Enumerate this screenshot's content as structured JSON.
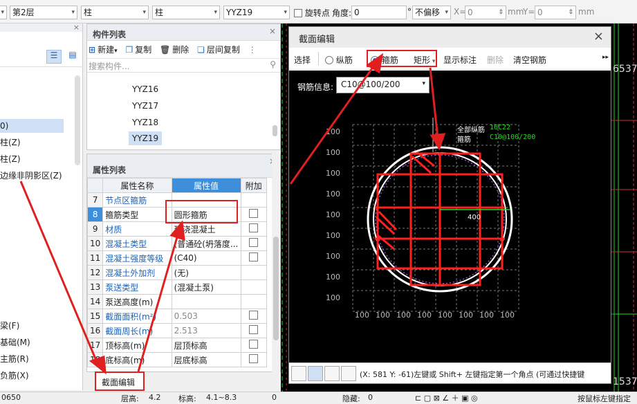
{
  "toolbar": {
    "floor": "第2层",
    "category": "柱",
    "subcategory": "柱",
    "component": "YYZ19",
    "rotate_point_label": "旋转点",
    "angle_label": "角度:",
    "angle_value": "0",
    "angle_unit": "°",
    "offset_mode": "不偏移",
    "x_label": "X=",
    "x_value": "0",
    "x_unit": "mm",
    "y_label": "Y=",
    "y_value": "0",
    "y_unit": "mm"
  },
  "tree": {
    "items": [
      "0)",
      "柱(Z)",
      "柱(Z)",
      "边缘非阴影区(Z)",
      "梁(F)",
      "基础(M)",
      "主筋(R)",
      "负筋(X)"
    ]
  },
  "component_list": {
    "title": "构件列表",
    "buttons": {
      "new": "新建",
      "copy": "复制",
      "delete": "删除",
      "floor_copy": "层间复制"
    },
    "search_placeholder": "搜索构件...",
    "items": [
      "YYZ16",
      "YYZ17",
      "YYZ18",
      "YYZ19"
    ],
    "selected": "YYZ19"
  },
  "property_list": {
    "title": "属性列表",
    "headers": {
      "name": "属性名称",
      "value": "属性值",
      "extra": "附加"
    },
    "rows": [
      {
        "no": "7",
        "name": "节点区箍筋",
        "value": ""
      },
      {
        "no": "8",
        "name": "箍筋类型",
        "value": "圆形箍筋"
      },
      {
        "no": "9",
        "name": "材质",
        "value": "现浇混凝土"
      },
      {
        "no": "10",
        "name": "混凝土类型",
        "value": "(普通砼(坍落度..."
      },
      {
        "no": "11",
        "name": "混凝土强度等级",
        "value": "(C40)"
      },
      {
        "no": "12",
        "name": "混凝土外加剂",
        "value": "(无)"
      },
      {
        "no": "13",
        "name": "泵送类型",
        "value": "(混凝土泵)"
      },
      {
        "no": "14",
        "name": "泵送高度(m)",
        "value": ""
      },
      {
        "no": "15",
        "name": "截面面积(m²)",
        "value": "0.503"
      },
      {
        "no": "16",
        "name": "截面周长(m)",
        "value": "2.513"
      },
      {
        "no": "17",
        "name": "顶标高(m)",
        "value": "层顶标高"
      },
      {
        "no": "18",
        "name": "底标高(m)",
        "value": "层底标高"
      }
    ]
  },
  "bottom_tab": "截面编辑",
  "status": {
    "left": "0650",
    "floor_h_label": "层高:",
    "floor_h": "4.2",
    "elev_label": "标高:",
    "elev": "4.1~8.3",
    "zero": "0",
    "hidden_label": "隐藏:",
    "hidden": "0",
    "hint": "按鼠标左键指定"
  },
  "cad_bg_labels": [
    "6537",
    "1537"
  ],
  "dialog": {
    "title": "截面编辑",
    "tools": {
      "select": "选择",
      "longitudinal": "纵筋",
      "stirrup": "箍筋",
      "shape": "矩形",
      "show_label": "显示标注",
      "delete": "删除",
      "clear": "清空钢筋"
    },
    "rebar_info_label": "钢筋信息:",
    "rebar_info_value": "C10@100/200",
    "anno_all_long": "全部纵筋",
    "anno_all_long_val": "16C22",
    "anno_stirrup": "箍筋",
    "anno_stirrup_val": "C10@100/200",
    "dim_radius": "400",
    "grid_labels_left": [
      "100",
      "100",
      "100",
      "100",
      "100",
      "100",
      "100",
      "100",
      "100"
    ],
    "grid_labels_bottom": [
      "100",
      "100",
      "100",
      "100",
      "100",
      "100",
      "100",
      "100"
    ],
    "footer_text": "(X: 581 Y: -61)左键或 Shift+ 左键指定第一个角点 (可通过快捷键"
  },
  "colors": {
    "accent_red": "#e02020",
    "value_header_blue": "#3e8fdb",
    "cad_green": "#22dd22"
  }
}
